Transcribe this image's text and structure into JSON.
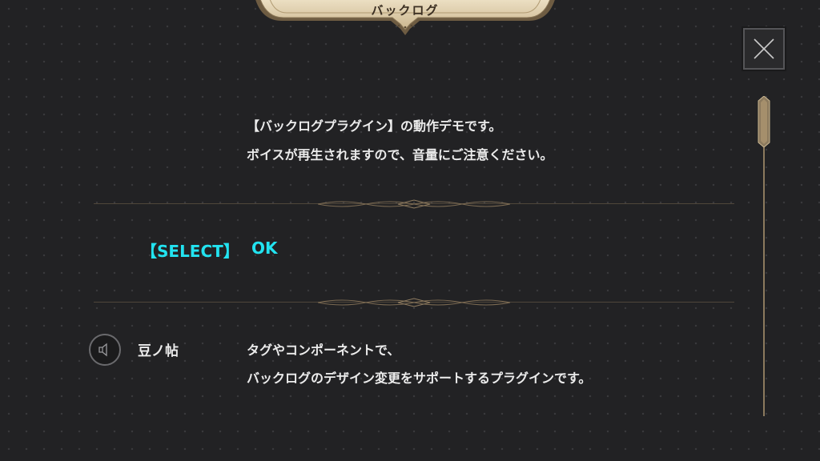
{
  "header": {
    "title": "バックログ"
  },
  "close_button": {
    "icon": "close-icon"
  },
  "log": [
    {
      "speaker": "",
      "lines": [
        "【バックログプラグイン】の動作デモです。",
        "ボイスが再生されますので、音量にご注意ください。"
      ]
    },
    {
      "select_label": "【SELECT】",
      "select_value": "OK"
    },
    {
      "speaker": "豆ノ帖",
      "lines": [
        "タグやコンポーネントで、",
        "バックログのデザイン変更をサポートするプラグインです。"
      ],
      "voice_icon": "speaker-icon"
    }
  ],
  "colors": {
    "background": "#222224",
    "select_text": "#22e3f0",
    "gold": "#c8b48c",
    "divider": "#4f463a"
  }
}
